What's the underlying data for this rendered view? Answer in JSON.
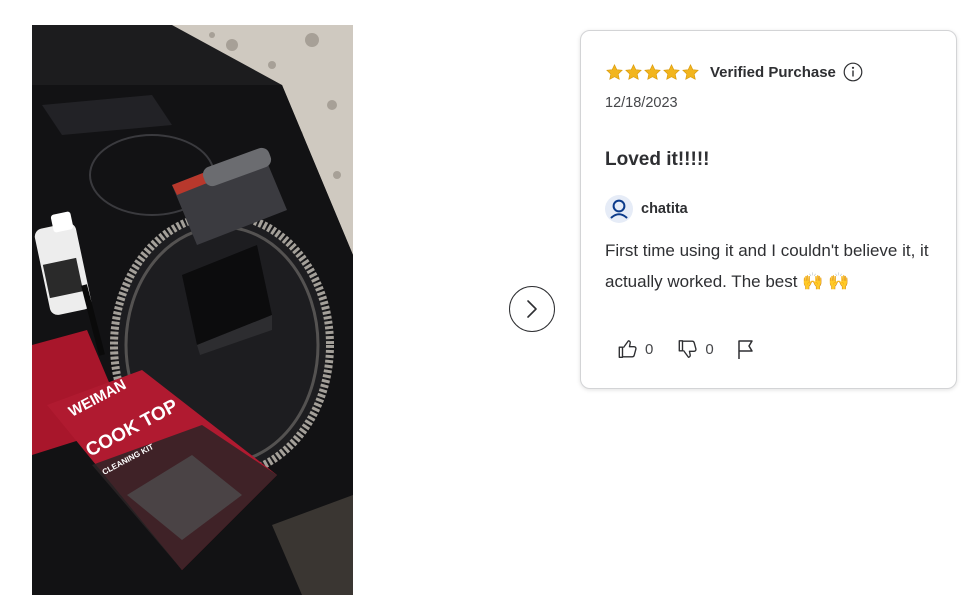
{
  "review": {
    "rating": 5,
    "rating_max": 5,
    "verified_label": "Verified Purchase",
    "date": "12/18/2023",
    "title": "Loved it!!!!!",
    "author": "chatita",
    "body": "First time using it and I couldn't believe it, it actually worked. The best 🙌 🙌",
    "helpful_count": "0",
    "unhelpful_count": "0"
  },
  "photo": {
    "box_brand": "WEIMAN",
    "box_product": "COOK TOP",
    "box_subtitle": "CLEANING KIT"
  },
  "icons": {
    "star": "star-icon",
    "info": "info-icon",
    "avatar": "person-icon",
    "thumbs_up": "thumbs-up-icon",
    "thumbs_down": "thumbs-down-icon",
    "report": "flag-icon",
    "next": "chevron-right-icon"
  },
  "colors": {
    "star": "#f2b51d",
    "text": "#2e2f32",
    "avatar_bg": "#e6ecf7",
    "avatar_icon": "#0b3a8a",
    "card_border": "#d3d4d6"
  }
}
